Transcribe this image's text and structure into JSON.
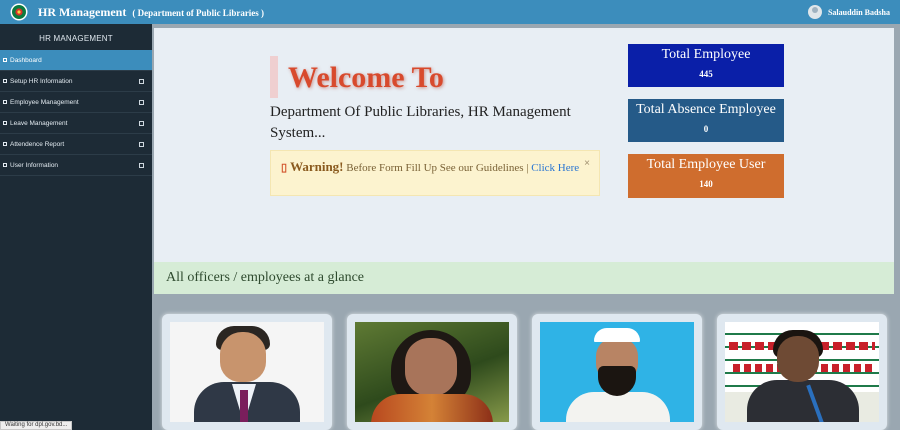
{
  "header": {
    "title": "HR Management",
    "subtitle": "( Department of Public Libraries )",
    "user_name": "Salauddin Badsha",
    "logo_icon": "bangladesh-emblem-icon",
    "colors": {
      "bar": "#3c8dbc"
    }
  },
  "sidebar": {
    "heading": "HR MANAGEMENT",
    "items": [
      {
        "label": "Dashboard",
        "active": true
      },
      {
        "label": "Setup HR Information"
      },
      {
        "label": "Employee Management"
      },
      {
        "label": "Leave Management"
      },
      {
        "label": "Attendence Report"
      },
      {
        "label": "User Information"
      }
    ]
  },
  "welcome": {
    "title": "Welcome To",
    "subtitle": "Department Of Public Libraries, HR Management System...",
    "warning": {
      "strong": "Warning!",
      "text": "Before Form Fill Up See our Guidelines",
      "separator": "|",
      "link": "Click Here",
      "close": "×"
    }
  },
  "stats": [
    {
      "label": "Total Employee",
      "value": "445",
      "color": "#0a1fa8"
    },
    {
      "label": "Total Absence Employee",
      "value": "0",
      "color": "#255a88"
    },
    {
      "label": "Total Employee User",
      "value": "140",
      "color": "#cf6d2e"
    }
  ],
  "glance": {
    "heading": "All officers / employees at a glance"
  },
  "status_bar": {
    "text": "Waiting for dpl.gov.bd..."
  }
}
